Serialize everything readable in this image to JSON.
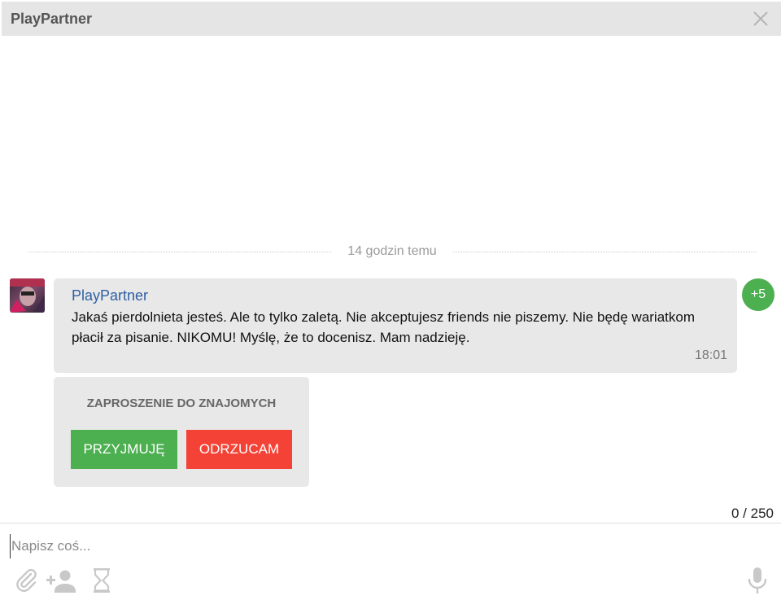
{
  "header": {
    "title": "PlayPartner",
    "close_icon": "close-icon"
  },
  "conversation": {
    "date_separator": "14 godzin temu",
    "message": {
      "sender": "PlayPartner",
      "text": "Jakaś pierdolnieta jesteś. Ale to tylko zaletą. Nie akceptujesz friends nie piszemy. Nie będę wariatkom płacił za pisanie. NIKOMU! Myślę, że to docenisz. Mam nadzieję.",
      "time": "18:01",
      "points_badge": "+5"
    },
    "friend_invite": {
      "title": "ZAPROSZENIE DO ZNAJOMYCH",
      "accept_label": "PRZYJMUJĘ",
      "reject_label": "ODRZUCAM"
    }
  },
  "composer": {
    "counter": "0 / 250",
    "placeholder": "Napisz coś...",
    "value": "",
    "tools": [
      "paperclip-icon",
      "add-friend-icon",
      "hourglass-icon",
      "microphone-icon"
    ]
  },
  "colors": {
    "accent_green": "#4caf50",
    "reject_red": "#f44336",
    "sender_blue": "#2f5fa3",
    "bubble_gray": "#e8e8e8",
    "header_gray": "#e5e5e5",
    "icon_gray": "#c8c8c8"
  }
}
